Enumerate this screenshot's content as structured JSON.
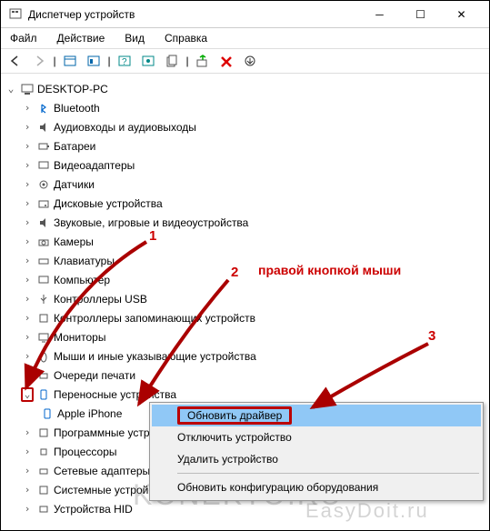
{
  "window": {
    "title": "Диспетчер устройств"
  },
  "menu": {
    "file": "Файл",
    "action": "Действие",
    "view": "Вид",
    "help": "Справка"
  },
  "tree": {
    "root": "DESKTOP-PC",
    "items": [
      "Bluetooth",
      "Аудиовходы и аудиовыходы",
      "Батареи",
      "Видеоадаптеры",
      "Датчики",
      "Дисковые устройства",
      "Звуковые, игровые и видеоустройства",
      "Камеры",
      "Клавиатуры",
      "Компьютер",
      "Контроллеры USB",
      "Контроллеры запоминающих устройств",
      "Мониторы",
      "Мыши и иные указывающие устройства",
      "Очереди печати",
      "Переносные устройства",
      "Apple iPhone",
      "Программные устройства",
      "Процессоры",
      "Сетевые адаптеры",
      "Системные устройства",
      "Устройства HID"
    ]
  },
  "context": {
    "update": "Обновить драйвер",
    "disable": "Отключить устройство",
    "uninstall": "Удалить устройство",
    "scan": "Обновить конфигурацию оборудования"
  },
  "annotations": {
    "n1": "1",
    "n2": "2",
    "n3": "3",
    "hint": "правой кнопкой мыши"
  },
  "watermark": {
    "a": "KONEKTO.RU",
    "b": "EasyDoit.ru"
  }
}
